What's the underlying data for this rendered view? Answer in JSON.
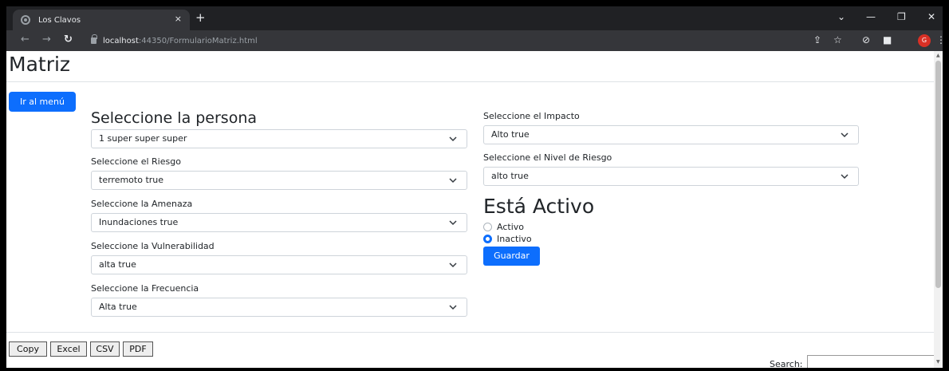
{
  "browser": {
    "tab_title": "Los Clavos",
    "tab_close": "×",
    "new_tab": "+",
    "url_host": "localhost",
    "url_path": ":44350/FormularioMatriz.html",
    "profile_initial": "G",
    "window_controls": {
      "dropdown": "⌄",
      "minimize": "—",
      "restore": "❐",
      "close": "✕"
    },
    "nav": {
      "back": "←",
      "forward": "→",
      "reload": "↻"
    }
  },
  "page": {
    "title": "Matriz",
    "menu_button": "Ir al menú",
    "persona_heading": "Seleccione la persona",
    "persona_value": "1 super super super",
    "riesgo_label": "Seleccione el Riesgo",
    "riesgo_value": "terremoto true",
    "amenaza_label": "Seleccione la Amenaza",
    "amenaza_value": "Inundaciones true",
    "vulnerabilidad_label": "Seleccione la Vulnerabilidad",
    "vulnerabilidad_value": "alta true",
    "frecuencia_label": "Seleccione la Frecuencia",
    "frecuencia_value": "Alta true",
    "impacto_label": "Seleccione el Impacto",
    "impacto_value": "Alto true",
    "nivel_label": "Seleccione el Nivel de Riesgo",
    "nivel_value": "alto true",
    "activo_heading": "Está Activo",
    "radio_activo": "Activo",
    "radio_inactivo": "Inactivo",
    "selected_radio": "Inactivo",
    "save_button": "Guardar"
  },
  "datatable": {
    "buttons": [
      "Copy",
      "Excel",
      "CSV",
      "PDF"
    ],
    "search_label": "Search:"
  },
  "colors": {
    "primary": "#0d6efd",
    "chrome_dark": "#202124",
    "chrome_toolbar": "#35363a",
    "profile": "#d93025"
  }
}
